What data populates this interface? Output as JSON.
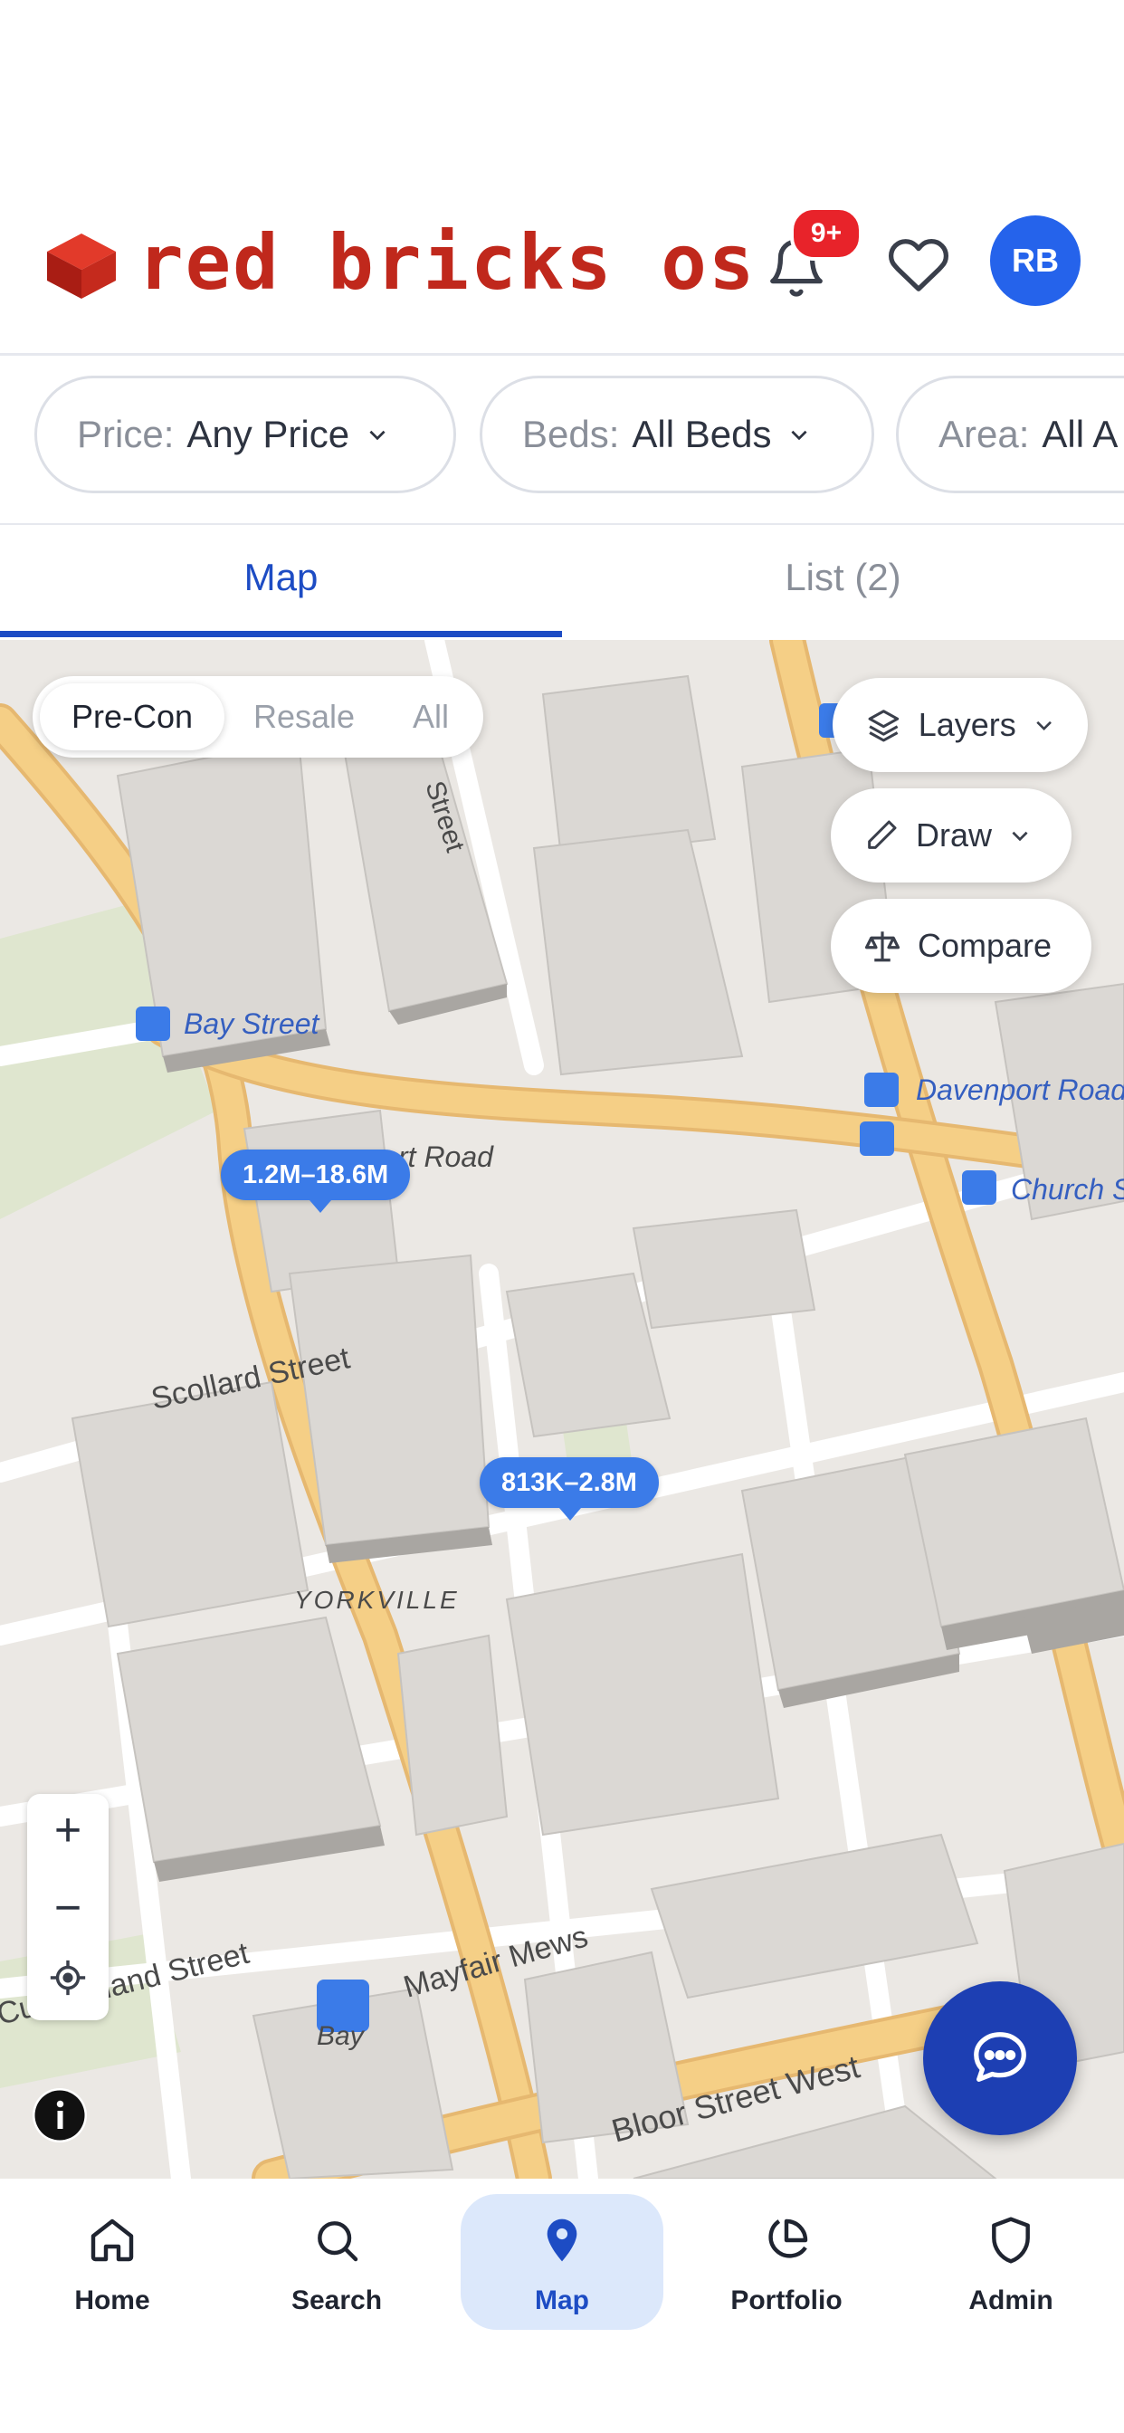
{
  "header": {
    "brand": "red bricks os",
    "notification_count": "9+",
    "avatar_initials": "RB"
  },
  "filters": [
    {
      "label": "Price:",
      "value": "Any Price"
    },
    {
      "label": "Beds:",
      "value": "All Beds"
    },
    {
      "label": "Area:",
      "value": "All A"
    }
  ],
  "tabs": {
    "map": "Map",
    "list": "List (2)",
    "active": "Map"
  },
  "map": {
    "listing_type": {
      "options": [
        "Pre-Con",
        "Resale",
        "All"
      ],
      "selected": "Pre-Con"
    },
    "controls": {
      "layers": "Layers",
      "draw": "Draw",
      "compare": "Compare"
    },
    "price_pins": [
      "1.2M–18.6M",
      "813K–2.8M"
    ],
    "labels": {
      "bay_street_stop": "Bay Street",
      "road_partial": "rt Road",
      "davenport": "Davenport Road",
      "church": "Church S",
      "scollard": "Scollard Street",
      "yorkville": "YORKVILLE",
      "cumberland": "Cumberland Street",
      "mayfair": "Mayfair Mews",
      "bay_station": "Bay",
      "bloor": "Bloor Street West",
      "street_vertical": "Street"
    },
    "zoom": {
      "in": "+",
      "out": "−"
    },
    "colors": {
      "pin": "#3b7be8",
      "road": "#f5cf86",
      "building": "#d6d3cf"
    }
  },
  "bottom_nav": [
    {
      "label": "Home",
      "icon": "home-icon"
    },
    {
      "label": "Search",
      "icon": "search-icon"
    },
    {
      "label": "Map",
      "icon": "map-pin-icon",
      "active": true
    },
    {
      "label": "Portfolio",
      "icon": "pie-chart-icon"
    },
    {
      "label": "Admin",
      "icon": "shield-icon"
    }
  ]
}
